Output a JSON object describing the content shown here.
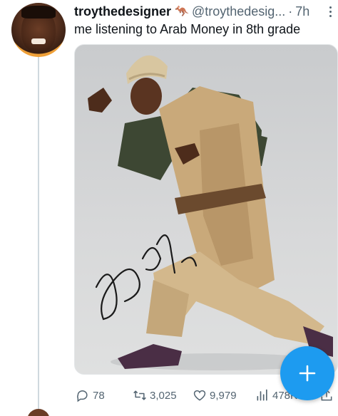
{
  "tweet": {
    "display_name": "troythedesigner",
    "verified_emoji": "🦘",
    "handle": "@troythedesig...",
    "separator": "·",
    "time": "7h",
    "text": "me listening to Arab Money in 8th grade"
  },
  "actions": {
    "replies": "78",
    "retweets": "3,025",
    "likes": "9,979",
    "views": "478K"
  },
  "colors": {
    "accent": "#1d9bf0",
    "secondary_text": "#536471",
    "thread_line": "#cfd9de"
  },
  "icons": {
    "more": "more-icon",
    "reply": "reply-icon",
    "retweet": "retweet-icon",
    "like": "heart-icon",
    "views": "views-icon",
    "share": "share-icon",
    "compose": "plus-icon"
  }
}
